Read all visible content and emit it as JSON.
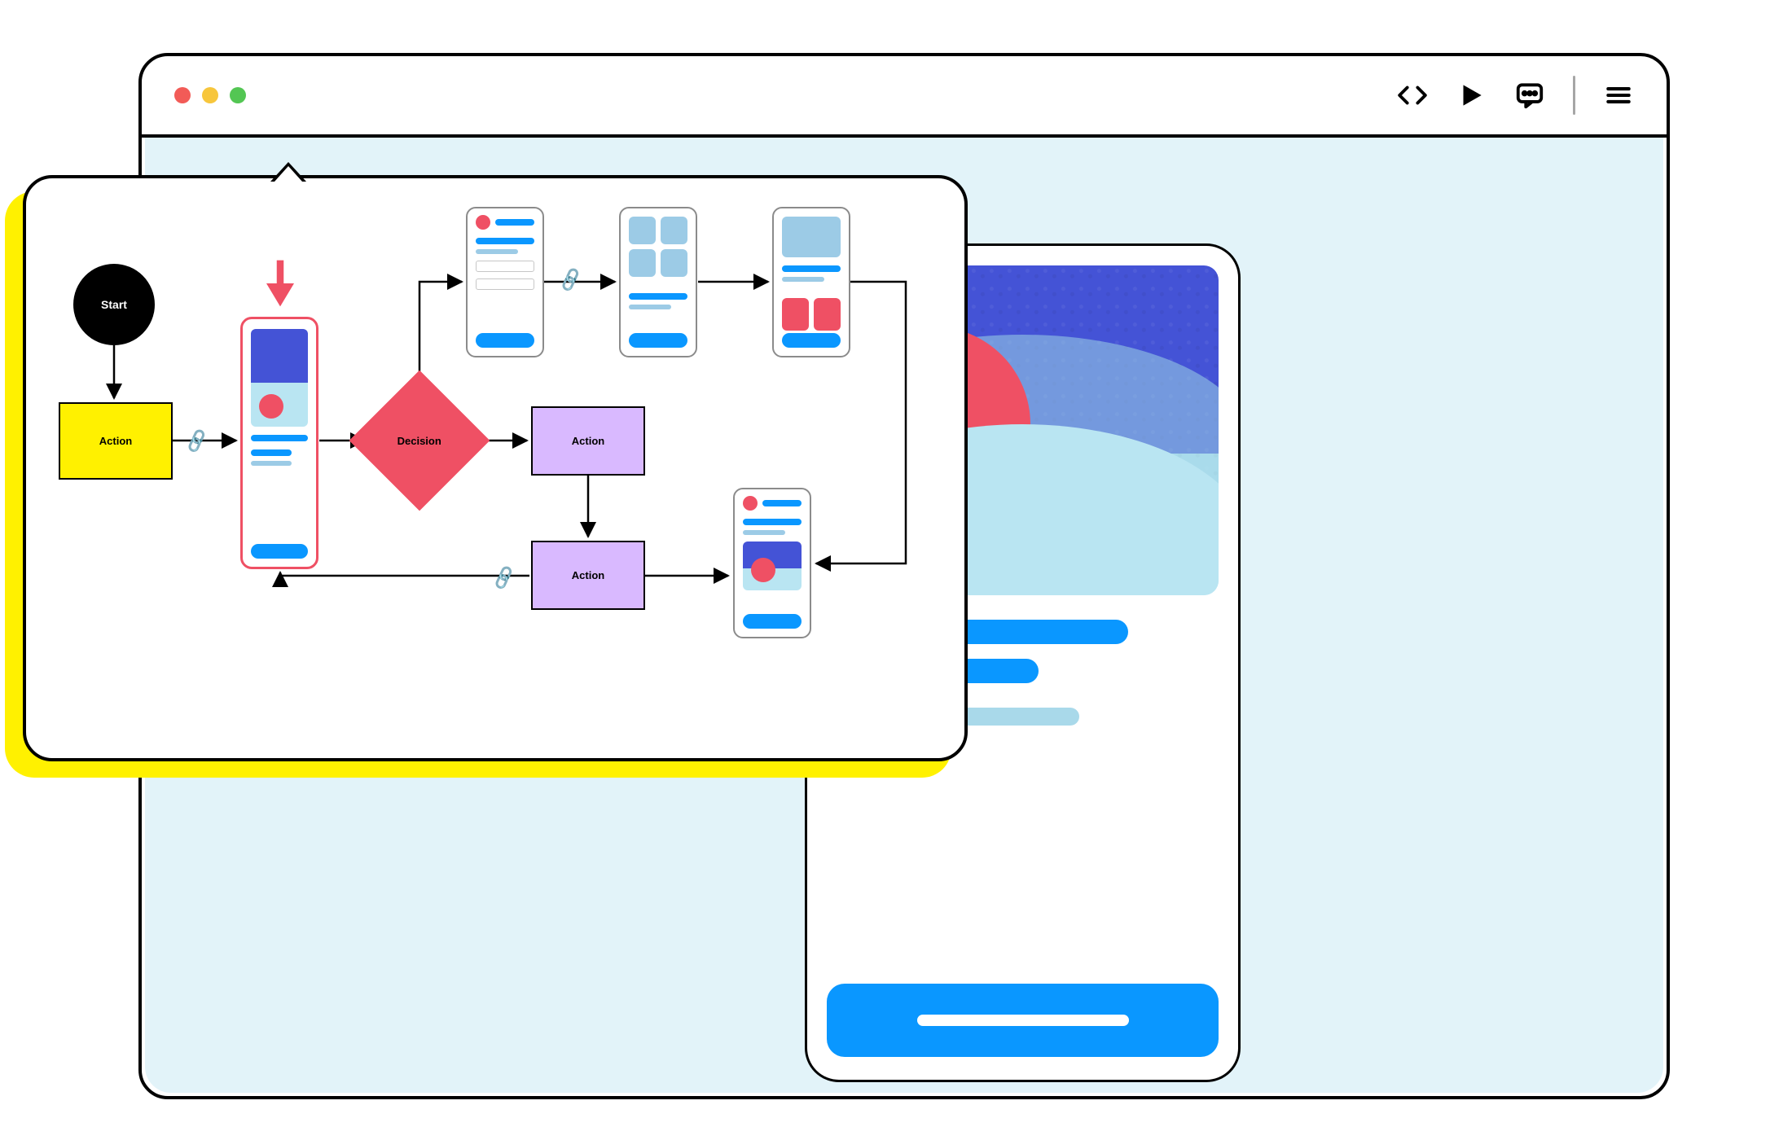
{
  "toolbar": {
    "dot_colors": [
      "#f25b57",
      "#f7c63c",
      "#53c653"
    ],
    "icons": [
      "code",
      "play",
      "comment",
      "menu"
    ]
  },
  "flowchart": {
    "start_label": "Start",
    "action_label_1": "Action",
    "action_label_2": "Action",
    "action_label_3": "Action",
    "decision_label": "Decision"
  },
  "colors": {
    "canvas": "#e2f3f9",
    "accent_blue": "#0a97ff",
    "accent_red": "#ef5064",
    "accent_yellow": "#fff100",
    "accent_purple": "#d9b9ff",
    "hero_blue": "#4453d6",
    "hero_sky": "#b9e5f2"
  }
}
